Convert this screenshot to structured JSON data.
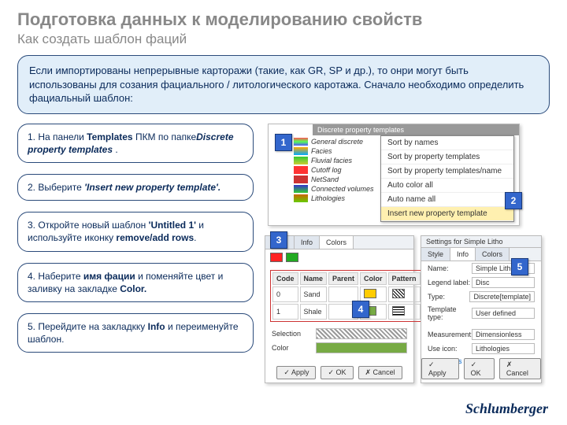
{
  "title": "Подготовка данных к моделированию свойств",
  "subtitle": "Как создать шаблон фаций",
  "intro": "Если импортированы непрерывные карторажи (такие, как GR, SP и др.), то онри могут быть использованы для созания фациального / литологического каротажа. Сначало необходимо определить фациальный шаблон:",
  "steps": {
    "s1a": "1. На панели ",
    "s1b": "Templates",
    "s1c": " ПКМ по папке",
    "s1d": "Discrete property templates",
    "s1e": " .",
    "s2a": "2. Выберите ",
    "s2b": "'Insert new property template'.",
    "s3a": "3. Откройте новый шаблон ",
    "s3b": "'Untitled 1'",
    "s3c": " и используйте иконку ",
    "s3d": "remove/add rows",
    "s3e": ".",
    "s4a": "4. Наберите ",
    "s4b": "имя фации",
    "s4c": " и поменяйте цвет и заливку на закладке ",
    "s4d": "Color.",
    "s5a": "5. Перейдите на закладкку ",
    "s5b": "Info",
    "s5c": " и переименуйте шаблон."
  },
  "tree": {
    "header": "Discrete property templates",
    "items": [
      "General discrete",
      "Facies",
      "Fluvial facies",
      "Cutoff log",
      "NetSand",
      "Connected volumes",
      "Lithologies"
    ]
  },
  "menu": {
    "i1": "Sort by names",
    "i2": "Sort by property templates",
    "i3": "Sort by property templates/name",
    "i4": "Auto color all",
    "i5": "Auto name all",
    "i6": "Insert new property template"
  },
  "dlg1": {
    "tabS": "Style",
    "tabI": "Info",
    "tabC": "Colors",
    "thCode": "Code",
    "thName": "Name",
    "thParent": "Parent",
    "thColor": "Color",
    "thPattern": "Pattern",
    "r0c": "0",
    "r0n": "Sand",
    "r1c": "1",
    "r1n": "Shale",
    "selLab": "Selection",
    "colLab": "Color",
    "apply": "✓ Apply",
    "ok": "✓ OK",
    "cancel": "✗ Cancel"
  },
  "dlg2": {
    "hdr": "Settings for Simple Litho",
    "tabS": "Style",
    "tabI": "Info",
    "tabC": "Colors",
    "nameL": "Name:",
    "nameV": "Simple Litho",
    "legL": "Legend label:",
    "legV": "Disc",
    "typeL": "Type:",
    "typeV": "Discrete[template]",
    "tplL": "Template type:",
    "tplV": "User defined",
    "measL": "Measurement:",
    "measV": "Dimensionless",
    "uicL": "Use icon:",
    "uicV": "Lithologies",
    "comL": "Comments"
  },
  "markers": {
    "m1": "1",
    "m2": "2",
    "m3": "3",
    "m4": "4",
    "m5": "5"
  },
  "logo": "Schlumberger"
}
